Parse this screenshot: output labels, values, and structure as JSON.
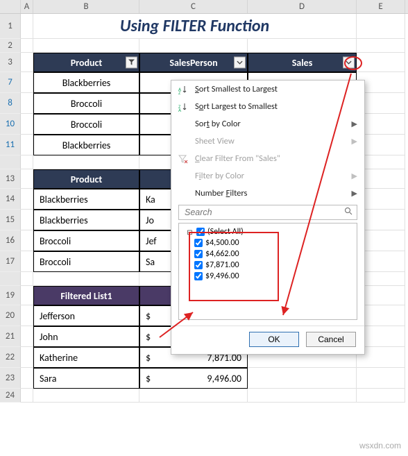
{
  "cols": [
    "A",
    "B",
    "C",
    "D",
    "E"
  ],
  "rownums": [
    "1",
    "2",
    "3",
    "7",
    "8",
    "10",
    "11",
    "",
    "13",
    "14",
    "15",
    "16",
    "17",
    "",
    "19",
    "20",
    "21",
    "22",
    "23",
    "24"
  ],
  "title": "Using FILTER Function",
  "table1": {
    "headers": [
      "Product",
      "SalesPerson",
      "Sales"
    ],
    "rows": [
      {
        "b": "Blackberries",
        "c": "",
        "d": ""
      },
      {
        "b": "Broccoli",
        "c": "",
        "d": ""
      },
      {
        "b": "Broccoli",
        "c": "",
        "d": ""
      },
      {
        "b": "Blackberries",
        "c": "",
        "d": ""
      }
    ]
  },
  "table2": {
    "header": "Product",
    "rows": [
      {
        "b": "Blackberries",
        "c": "Ka"
      },
      {
        "b": "Blackberries",
        "c": "Jo"
      },
      {
        "b": "Broccoli",
        "c": "Jef"
      },
      {
        "b": "Broccoli",
        "c": "Sa"
      }
    ]
  },
  "table3": {
    "header": "Filtered List1",
    "rows": [
      {
        "b": "Jefferson",
        "c_l": "$",
        "c_r": ""
      },
      {
        "b": "John",
        "c_l": "$",
        "c_r": ""
      },
      {
        "b": "Katherine",
        "c_l": "$",
        "c_r": "7,871.00"
      },
      {
        "b": "Sara",
        "c_l": "$",
        "c_r": "9,496.00"
      }
    ]
  },
  "menu": {
    "sortAsc": "Sort Smallest to Largest",
    "sortDesc": "Sort Largest to Smallest",
    "sortColor": "Sort by Color",
    "sheetView": "Sheet View",
    "clearFilter": "Clear Filter From \"Sales\"",
    "filterColor": "Filter by Color",
    "numberFilters": "Number Filters",
    "searchPlaceholder": "Search",
    "items": [
      "(Select All)",
      "$4,500.00",
      "$4,662.00",
      "$7,871.00",
      "$9,496.00"
    ],
    "ok": "OK",
    "cancel": "Cancel"
  },
  "watermark": "wsxdn.com",
  "chart_data": {
    "type": "table",
    "title": "Filter menu values for Sales column",
    "values": [
      4500.0,
      4662.0,
      7871.0,
      9496.0
    ]
  }
}
